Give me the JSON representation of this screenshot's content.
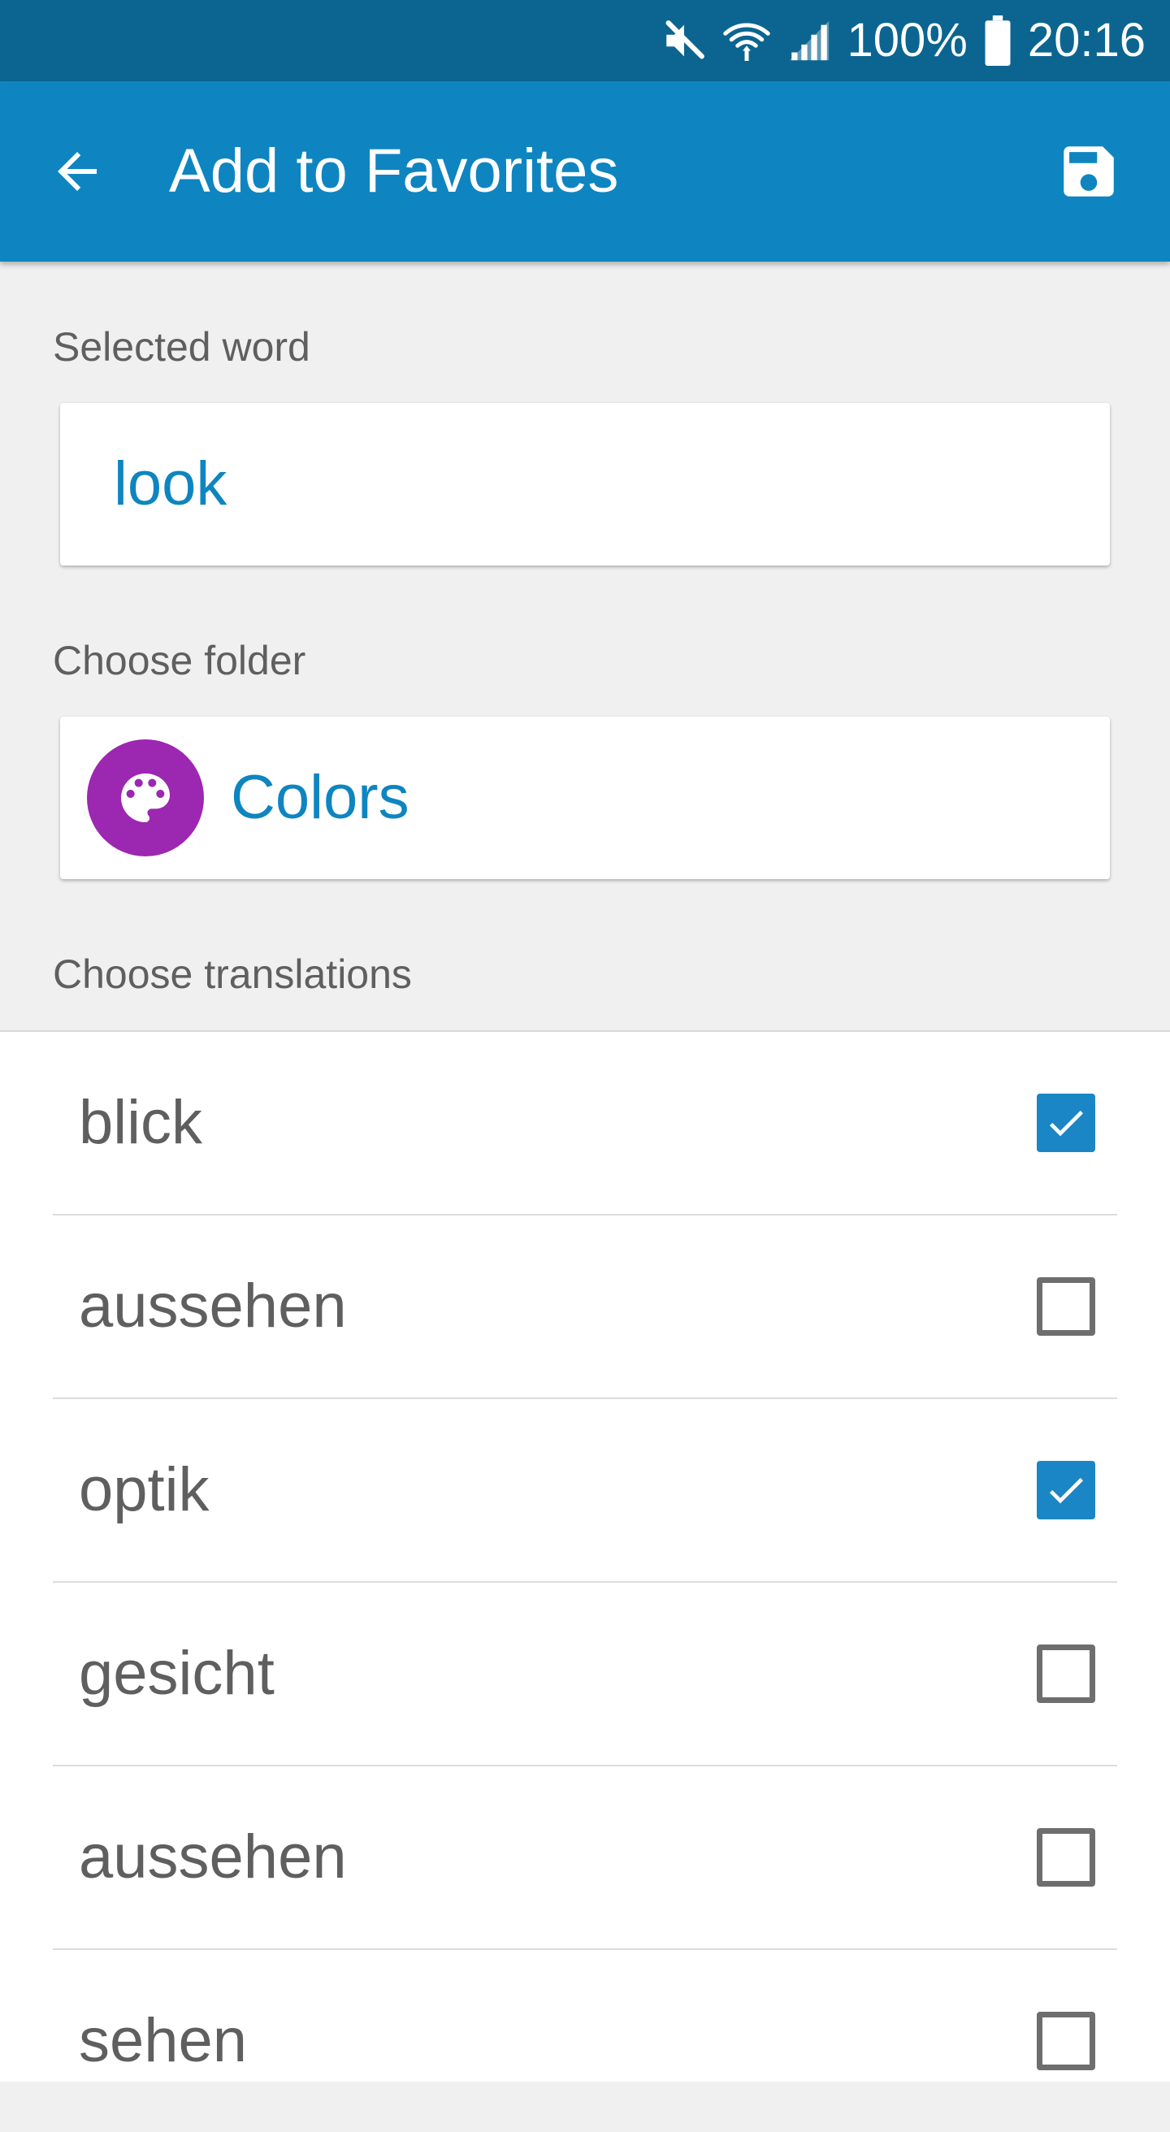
{
  "status_bar": {
    "icons": [
      "mute-icon",
      "wifi-icon",
      "signal-icon",
      "battery-icon"
    ],
    "battery": "100%",
    "time": "20:16"
  },
  "app_bar": {
    "title": "Add to Favorites",
    "back_icon": "arrow-back-icon",
    "save_icon": "floppy-disk-icon"
  },
  "form": {
    "selected_word_label": "Selected word",
    "selected_word_value": "look",
    "folder_label": "Choose folder",
    "folder_name": "Colors",
    "folder_icon": "palette-icon",
    "folder_color": "#9c27b0",
    "translations_label": "Choose translations"
  },
  "translations": [
    {
      "label": "blick",
      "checked": true
    },
    {
      "label": "aussehen",
      "checked": false
    },
    {
      "label": "optik",
      "checked": true
    },
    {
      "label": "gesicht",
      "checked": false
    },
    {
      "label": "aussehen",
      "checked": false
    },
    {
      "label": "sehen",
      "checked": false
    }
  ],
  "colors": {
    "status_bar": "#0b6590",
    "app_bar": "#0e85c0",
    "accent": "#1b86c6",
    "background": "#f0f0f0"
  }
}
